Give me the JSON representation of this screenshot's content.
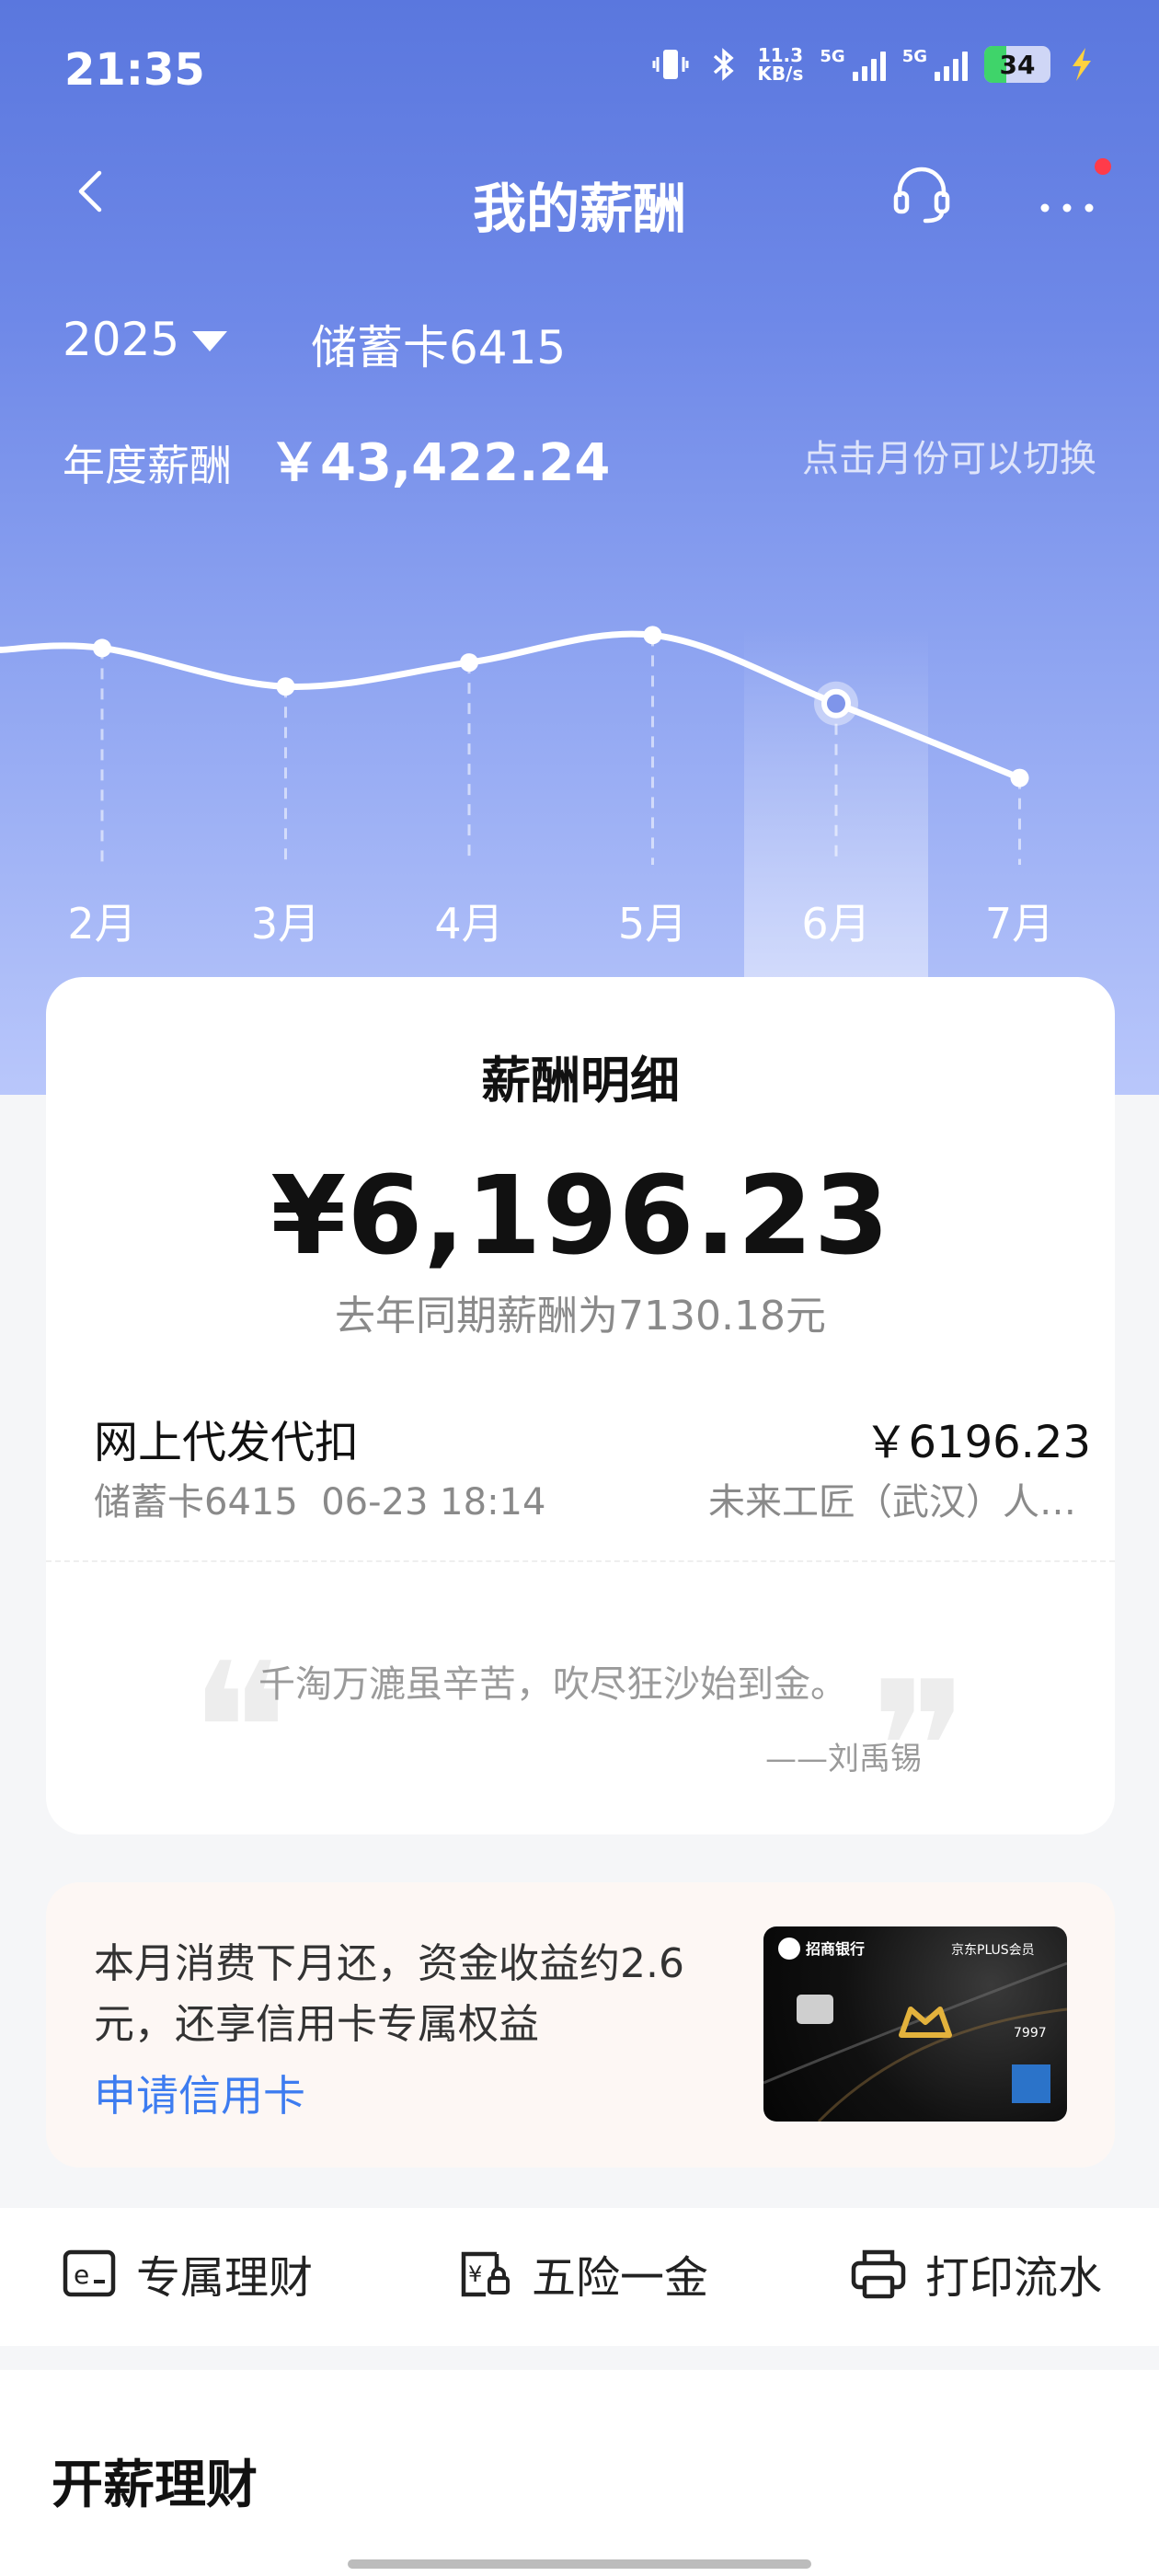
{
  "status_bar": {
    "time": "21:35",
    "net_speed_value": "11.3",
    "net_speed_unit": "KB/s",
    "sim1_label": "5G",
    "sim2_label": "5G",
    "battery": "34",
    "battery_level": 0.34
  },
  "nav": {
    "title": "我的薪酬"
  },
  "filters": {
    "year": "2025",
    "card": "储蓄卡6415"
  },
  "summary": {
    "annual_label": "年度薪酬",
    "annual_amount": "￥43,422.24",
    "hint": "点击月份可以切换"
  },
  "chart_data": {
    "type": "line",
    "categories": [
      "2月",
      "3月",
      "4月",
      "5月",
      "6月",
      "7月"
    ],
    "selected": "6月",
    "series": [
      {
        "values": [
          7350,
          6550,
          7050,
          7620,
          6196.23,
          4650
        ]
      }
    ],
    "ylim": [
      3800,
      8200
    ],
    "grid": false,
    "colors": {
      "line": "#ffffff",
      "highlight": "#ffffff"
    }
  },
  "detail": {
    "title": "薪酬明细",
    "amount": "¥6,196.23",
    "last_year": "去年同期薪酬为7130.18元",
    "record": {
      "name": "网上代发代扣",
      "amount": "￥6196.23",
      "sub": "储蓄卡6415  06-23 18:14",
      "company": "未来工匠（武汉）人…"
    },
    "quote": "千淘万漉虽辛苦，吹尽狂沙始到金。",
    "author": "——刘禹锡"
  },
  "promo": {
    "text": "本月消费下月还，资金收益约2.6元，还享信用卡专属权益",
    "link": "申请信用卡",
    "card_bank": "招商银行",
    "card_plus": "京东PLUS会员",
    "card_number": "7997"
  },
  "actions": [
    {
      "label": "专属理财",
      "icon": "e-finance-icon"
    },
    {
      "label": "五险一金",
      "icon": "insurance-fund-icon"
    },
    {
      "label": "打印流水",
      "icon": "printer-icon"
    }
  ],
  "section": {
    "title": "开薪理财"
  },
  "colors": {
    "accent": "#3d7cf0",
    "hero_top": "#5a77de",
    "hero_bottom": "#b9c7fb"
  }
}
